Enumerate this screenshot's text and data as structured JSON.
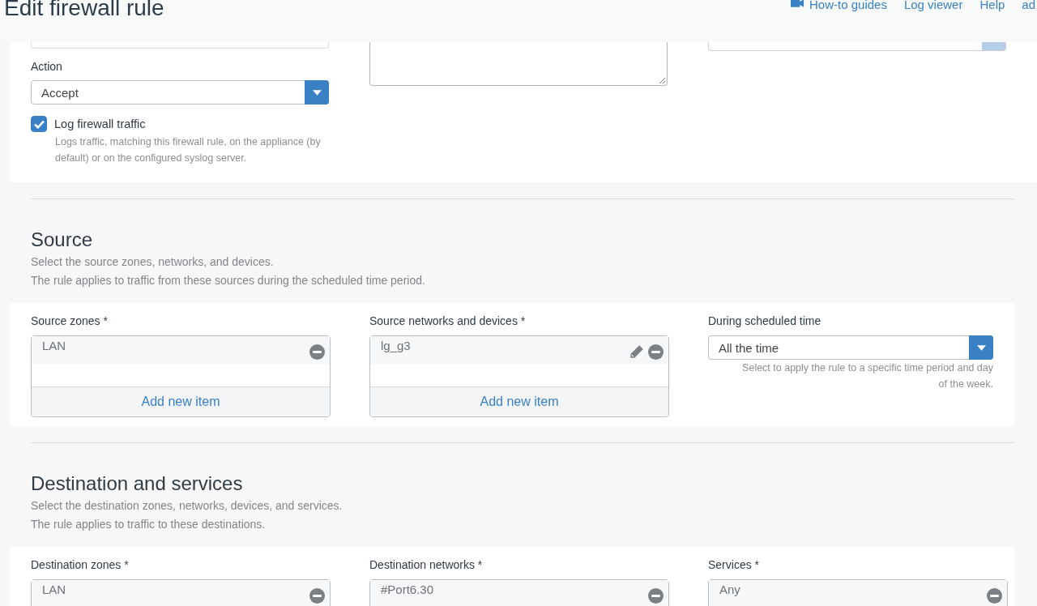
{
  "header": {
    "title": "Edit firewall rule",
    "links": [
      {
        "label": "How-to guides",
        "icon": true
      },
      {
        "label": "Log viewer",
        "icon": false
      },
      {
        "label": "Help",
        "icon": false
      },
      {
        "label": "ad",
        "icon": false
      }
    ]
  },
  "general": {
    "action": {
      "label": "Action",
      "value": "Accept"
    },
    "log": {
      "label": "Log firewall traffic",
      "checked": true,
      "help": "Logs traffic, matching this firewall rule, on the appliance (by default) or on the configured syslog server."
    },
    "has_description": true
  },
  "sections": [
    {
      "title": "Source",
      "description": [
        "Select the source zones, networks, and devices.",
        "The rule applies to traffic from these sources during the scheduled time period."
      ],
      "fields": [
        {
          "kind": "list",
          "label": "Source zones *",
          "items": [
            {
              "label": "LAN",
              "editable": false
            }
          ],
          "add_label": "Add new item"
        },
        {
          "kind": "list",
          "label": "Source networks and devices *",
          "items": [
            {
              "label": "lg_g3",
              "editable": true
            }
          ],
          "add_label": "Add new item"
        },
        {
          "kind": "select",
          "label": "During scheduled time",
          "value": "All the time",
          "help": "Select to apply the rule to a specific time period and day of the week."
        }
      ]
    },
    {
      "title": "Destination and services",
      "description": [
        "Select the destination zones, networks, devices, and services.",
        "The rule applies to traffic to these destinations."
      ],
      "fields": [
        {
          "kind": "list",
          "label": "Destination zones *",
          "items": [
            {
              "label": "LAN",
              "editable": false
            }
          ]
        },
        {
          "kind": "list",
          "label": "Destination networks *",
          "items": [
            {
              "label": "#Port6.30",
              "editable": false
            }
          ]
        },
        {
          "kind": "list",
          "label": "Services *",
          "items": [
            {
              "label": "Any",
              "editable": false
            }
          ]
        }
      ]
    }
  ]
}
